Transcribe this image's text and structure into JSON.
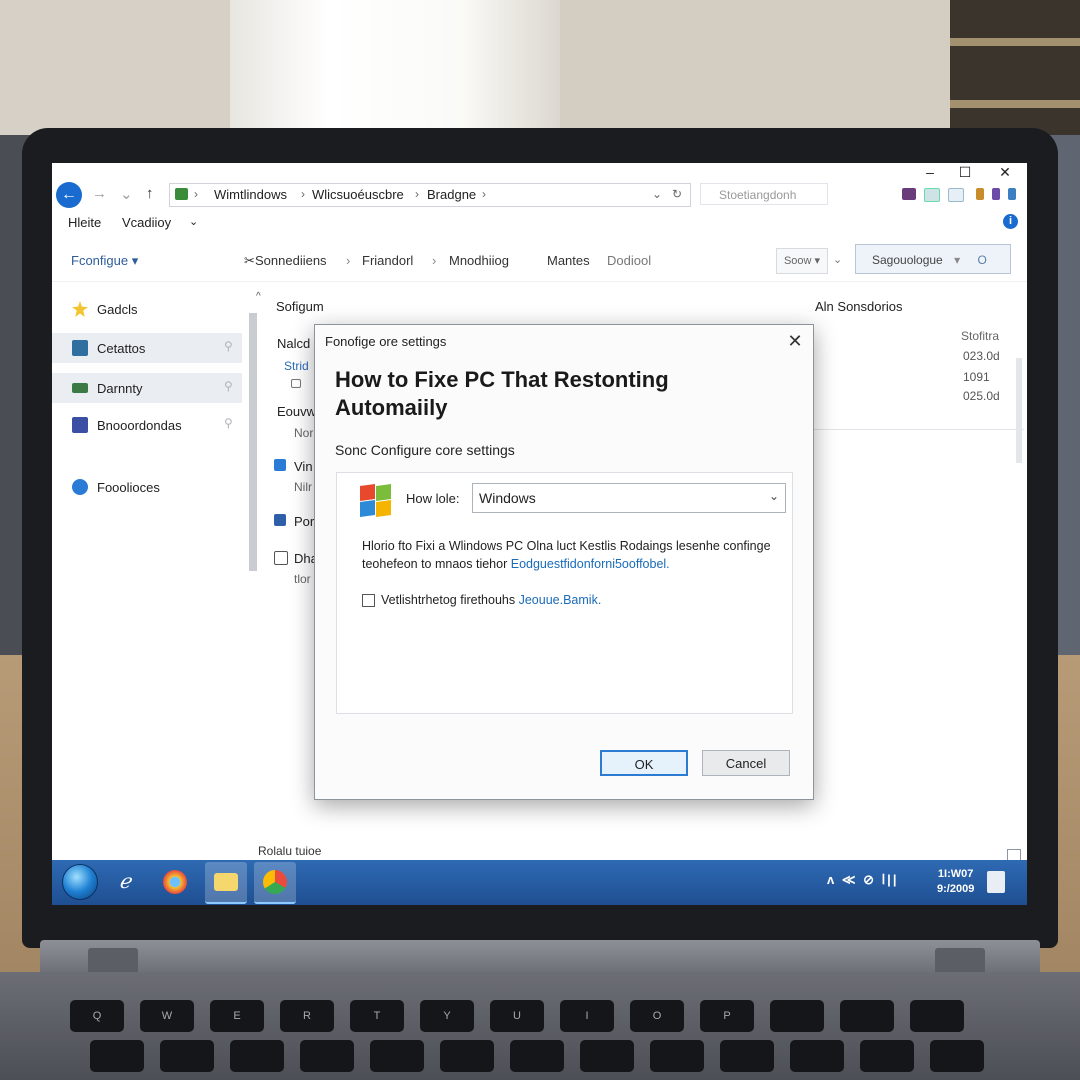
{
  "explorer": {
    "address": {
      "crumbs": [
        "Wimtlindows",
        "Wlicsuoéuscbre",
        "Bradgne"
      ]
    },
    "search_placeholder": "Stoetiangdonh",
    "menu": [
      "Hleite",
      "Vcadiioy"
    ],
    "toolbar": {
      "configure": "Fconfigue",
      "crumbs": [
        "Sonnediiens",
        "Friandorl",
        "Mnodhiiog",
        "Mantes",
        "Dodiool"
      ],
      "sort": "Soow",
      "search_pill": "Sagouologue",
      "search_pill_glyph": "O"
    },
    "nav": [
      {
        "label": "Gadcls",
        "icon": "star-icon"
      },
      {
        "label": "Cetattos",
        "icon": "desktop-icon"
      },
      {
        "label": "Darnnty",
        "icon": "drive-icon"
      },
      {
        "label": "Bnooordondas",
        "icon": "document-icon"
      },
      {
        "label": "Fooolioces",
        "icon": "globe-icon"
      }
    ],
    "content": {
      "col_name": "Sofigum",
      "col_right": "Aln Sonsdorios",
      "col_size": "Stofitra",
      "rows": [
        "Nalcd",
        "Strid",
        "Eouvw",
        "Nor",
        "Vin",
        "Nilr",
        "Por",
        "Dha",
        "tlor"
      ],
      "sizes": [
        "023.0d",
        "1091",
        "025.0d"
      ]
    },
    "status": "Rolalu tuioe"
  },
  "dialog": {
    "title": "Fonofige ore settings",
    "heading": "How to Fixe PC That Restonting Automaiily",
    "subtitle": "Sonc Configure core settings",
    "how_label": "How lole:",
    "select_value": "Windows",
    "desc_text": "Hlorio fto Fixi a Wlindows PC Olna luct Kestlis Rodaings lesenhe confinge teohefeon to mnaos tiehor",
    "desc_link": "Eodguestfidonforni5ooffobel.",
    "checkbox_text": "Vetlishtrhetog firethouhs",
    "checkbox_link": "Jeouue.Bamik.",
    "ok": "OK",
    "cancel": "Cancel"
  },
  "taskbar": {
    "tray": "ʌ ≪ ⊘ ⅼ|| ",
    "clock_line1": "1I:W07",
    "clock_line2": "9:/2009"
  },
  "keyboard": [
    "Q",
    "W",
    "E",
    "R",
    "T",
    "Y",
    "U",
    "I",
    "O",
    "P"
  ]
}
